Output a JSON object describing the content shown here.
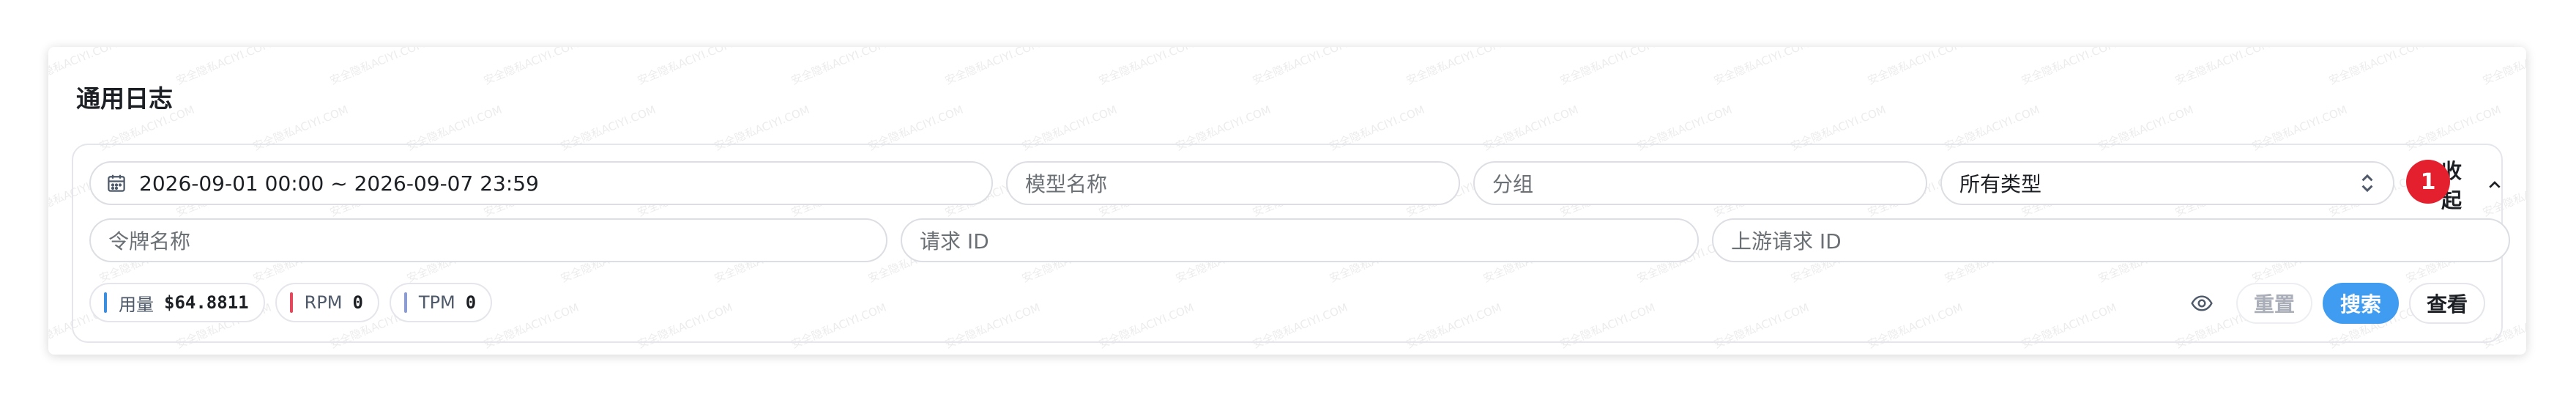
{
  "card": {
    "title": "通用日志"
  },
  "filters": {
    "date_range": "2026-09-01 00:00 ~ 2026-09-07 23:59",
    "model_placeholder": "模型名称",
    "group_placeholder": "分组",
    "type_value": "所有类型",
    "token_placeholder": "令牌名称",
    "request_id_placeholder": "请求 ID",
    "upstream_request_id_placeholder": "上游请求 ID",
    "collapse_label": "收起"
  },
  "notification": {
    "count": "1"
  },
  "stats": [
    {
      "label": "用量",
      "value": "$64.8811",
      "color": "#3b8fe0"
    },
    {
      "label": "RPM",
      "value": "0",
      "color": "#e5485d"
    },
    {
      "label": "TPM",
      "value": "0",
      "color": "#8b9bd4"
    }
  ],
  "actions": {
    "reset": "重置",
    "search": "搜索",
    "view": "查看"
  },
  "watermark": {
    "text": "安全隐私ACIYI.COM"
  }
}
